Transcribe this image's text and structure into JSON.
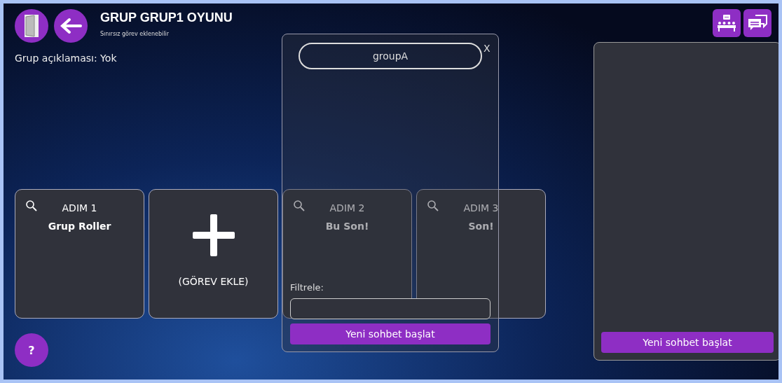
{
  "header": {
    "title": "GRUP GRUP1 OYUNU",
    "subtitle": "Sınırsız görev eklenebilir",
    "description": "Grup açıklaması: Yok"
  },
  "cards": [
    {
      "kind": "step",
      "step": "ADIM 1",
      "name": "Grup Roller"
    },
    {
      "kind": "add",
      "label": "(GÖREV EKLE)"
    },
    {
      "kind": "step",
      "step": "ADIM 2",
      "name": "Bu Son!"
    },
    {
      "kind": "step",
      "step": "ADIM 3",
      "name": "Son!"
    }
  ],
  "help_button": {
    "label": "?"
  },
  "chat_popup": {
    "group_name": "groupA",
    "close": "X",
    "filter_label": "Filtrele:",
    "button": "Yeni sohbet başlat"
  },
  "side_panel": {
    "button": "Yeni sohbet başlat"
  }
}
